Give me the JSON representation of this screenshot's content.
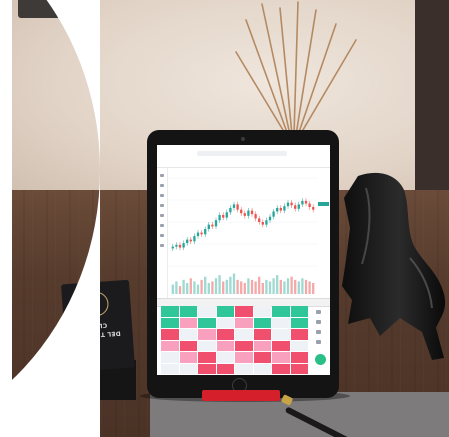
{
  "colors": {
    "wall": "#e6d8cb",
    "table_wood": "#5a3d2e",
    "ipad_bezel": "#141414",
    "stand": "#d51f2a",
    "bull": "#161616",
    "card": "#1b1b1d",
    "candle_up": "#26a69a",
    "candle_down": "#ef5350",
    "heat_green": "#2fc79a",
    "heat_red": "#f0506e",
    "heat_pink": "#f8a0bd",
    "heat_light": "#eef2f7"
  },
  "card": {
    "logo_glyph": "⊙",
    "line1": "CLUB",
    "line2": "DEL TRADER",
    "line3": "",
    "line4": ""
  },
  "icons": [
    "home-button-icon",
    "camera-icon",
    "drawing-tool-icon",
    "floating-action-icon"
  ],
  "chart_data": {
    "type": "line",
    "description_visible": "candlestick price chart with volume bars",
    "x": [
      1,
      2,
      3,
      4,
      5,
      6,
      7,
      8,
      9,
      10,
      11,
      12,
      13,
      14,
      15,
      16,
      17,
      18,
      19,
      20,
      21,
      22,
      23,
      24,
      25,
      26,
      27,
      28,
      29,
      30,
      31,
      32,
      33,
      34,
      35,
      36,
      37,
      38,
      39,
      40
    ],
    "series": [
      {
        "values": [
          22,
          24,
          21,
          26,
          30,
          28,
          34,
          38,
          36,
          42,
          47,
          45,
          52,
          58,
          55,
          61,
          66,
          70,
          64,
          60,
          57,
          63,
          59,
          54,
          50,
          47,
          52,
          56,
          62,
          66,
          63,
          68,
          72,
          69,
          65,
          70,
          74,
          71,
          67,
          64
        ]
      }
    ],
    "volume": [
      6,
      8,
      5,
      9,
      7,
      10,
      8,
      6,
      9,
      11,
      7,
      8,
      10,
      12,
      8,
      9,
      11,
      13,
      9,
      8,
      7,
      10,
      9,
      8,
      11,
      7,
      9,
      8,
      10,
      12,
      9,
      8,
      10,
      11,
      9,
      8,
      10,
      9,
      8,
      7
    ],
    "ylim": [
      0,
      100
    ]
  },
  "heatmap": {
    "rows": [
      [
        "g",
        "g",
        "l",
        "g",
        "r",
        "l",
        "g",
        "g"
      ],
      [
        "g",
        "p",
        "g",
        "l",
        "p",
        "g",
        "l",
        "g"
      ],
      [
        "r",
        "l",
        "p",
        "r",
        "l",
        "r",
        "l",
        "r"
      ],
      [
        "p",
        "r",
        "l",
        "p",
        "r",
        "p",
        "r",
        "l"
      ],
      [
        "l",
        "p",
        "r",
        "l",
        "p",
        "r",
        "p",
        "r"
      ],
      [
        "l",
        "l",
        "r",
        "r",
        "l",
        "l",
        "r",
        "r"
      ]
    ]
  }
}
